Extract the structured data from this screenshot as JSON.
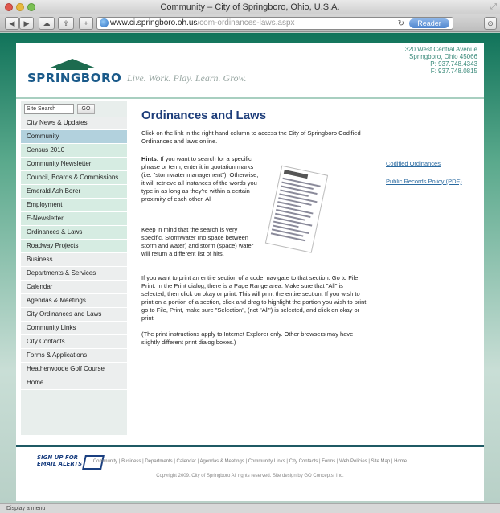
{
  "window": {
    "title": "Community – City of Springboro, Ohio, U.S.A.",
    "url_host": "www.ci.springboro.oh.us",
    "url_path": "/com-ordinances-laws.aspx",
    "reader_label": "Reader",
    "status_text": "Display a menu"
  },
  "header": {
    "logo_text": "SPRINGBORO",
    "tagline": "Live. Work. Play. Learn. Grow.",
    "address": [
      "320 West Central Avenue",
      "Springboro, Ohio 45066",
      "P: 937.748.4343",
      "F: 937.748.0815"
    ]
  },
  "sidebar": {
    "search_value": "Site Search",
    "go_label": "GO",
    "items": [
      {
        "label": "City News & Updates",
        "style": "grey"
      },
      {
        "label": "Community",
        "style": "active"
      },
      {
        "label": "Census 2010",
        "style": "green"
      },
      {
        "label": "Community Newsletter",
        "style": "green"
      },
      {
        "label": "Council, Boards & Commissions",
        "style": "green"
      },
      {
        "label": "Emerald Ash Borer",
        "style": "green"
      },
      {
        "label": "Employment",
        "style": "green"
      },
      {
        "label": "E-Newsletter",
        "style": "green"
      },
      {
        "label": "Ordinances & Laws",
        "style": "green"
      },
      {
        "label": "Roadway Projects",
        "style": "green"
      },
      {
        "label": "Business",
        "style": "grey"
      },
      {
        "label": "Departments & Services",
        "style": "grey"
      },
      {
        "label": "Calendar",
        "style": "grey"
      },
      {
        "label": "Agendas & Meetings",
        "style": "grey"
      },
      {
        "label": "City Ordinances and Laws",
        "style": "grey"
      },
      {
        "label": "Community Links",
        "style": "grey"
      },
      {
        "label": "City Contacts",
        "style": "grey"
      },
      {
        "label": "Forms & Applications",
        "style": "grey"
      },
      {
        "label": "Heatherwoode Golf Course",
        "style": "grey"
      },
      {
        "label": "Home",
        "style": "grey"
      }
    ],
    "email_alert": [
      "SIGN UP FOR",
      "EMAIL ALERTS"
    ]
  },
  "main": {
    "title": "Ordinances and Laws",
    "intro": "Click on the link in the right hand column to access the City of Springboro Codified Ordinances and laws online.",
    "hints_label": "Hints:",
    "hints": " If you want to search for a specific phrase or term, enter it in quotation marks (i.e. \"stormwater management\"). Otherwise, it will retrieve all instances of the words you type in as long as they're within a certain proximity of each other. Al",
    "keep_in_mind": "Keep in mind that the search is very specific. Stormwater (no space between storm and water) and storm (space) water will return a different list of hits.",
    "print_section": "If you want to print an entire section of a code, navigate to that section. Go to File, Print. In the Print dialog, there is a Page Range area. Make sure that \"All\" is selected, then click on okay or print. This will print the entire section. If you wish to print on a portion of a section, click and drag to highlight the portion you wish to print, go to File, Print, make sure \"Selection\", (not \"All\") is selected, and click on okay or print.",
    "print_note": "(The print instructions apply to Internet Explorer only. Other browsers may have slightly different print dialog boxes.)"
  },
  "right_links": [
    "Codified Ordinances",
    "Public Records Policy (PDF)"
  ],
  "footer": {
    "nav": "Community | Business | Departments | Calendar | Agendas & Meetings | Community Links | City Contacts | Forms | Web Policies | Site Map | Home",
    "copyright": "Copyright 2009. City of Springboro All rights reserved. Site design by GO Concepts, Inc."
  }
}
